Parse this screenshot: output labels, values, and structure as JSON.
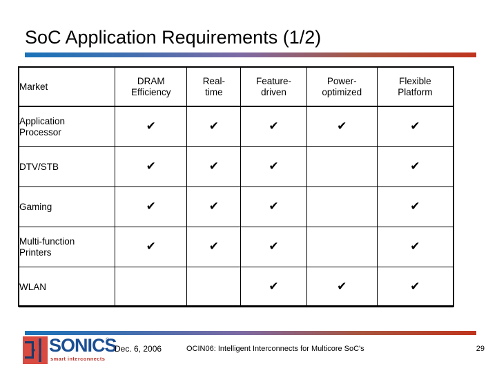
{
  "slide": {
    "title": "SoC Application Requirements (1/2)",
    "accent_blue": "#1a72b8",
    "accent_red": "#c0341d"
  },
  "table": {
    "columns": [
      "Market",
      "DRAM Efficiency",
      "Real-time",
      "Feature-driven",
      "Power-optimized",
      "Flexible Platform"
    ],
    "column_lines": [
      [
        "Market",
        ""
      ],
      [
        "DRAM",
        "Efficiency"
      ],
      [
        "Real-",
        "time"
      ],
      [
        "Feature-",
        "driven"
      ],
      [
        "Power-",
        "optimized"
      ],
      [
        "Flexible",
        "Platform"
      ]
    ],
    "check_symbol": "✔",
    "rows": [
      {
        "market_lines": [
          "Application",
          "Processor"
        ],
        "market": "Application Processor",
        "cells": [
          "✔",
          "✔",
          "✔",
          "✔",
          "✔"
        ]
      },
      {
        "market_lines": [
          "DTV/STB",
          ""
        ],
        "market": "DTV/STB",
        "cells": [
          "✔",
          "✔",
          "✔",
          "",
          "✔"
        ]
      },
      {
        "market_lines": [
          "Gaming",
          ""
        ],
        "market": "Gaming",
        "cells": [
          "✔",
          "✔",
          "✔",
          "",
          "✔"
        ]
      },
      {
        "market_lines": [
          "Multi-function",
          "Printers"
        ],
        "market": "Multi-function Printers",
        "cells": [
          "✔",
          "✔",
          "✔",
          "",
          "✔"
        ]
      },
      {
        "market_lines": [
          "WLAN",
          ""
        ],
        "market": "WLAN",
        "cells": [
          "",
          "",
          "✔",
          "✔",
          "✔"
        ]
      }
    ]
  },
  "footer": {
    "logo_word": "SONICS",
    "logo_registered": "®",
    "logo_tagline": "smart interconnects",
    "date": "Dec. 6, 2006",
    "conference": "OCIN06: Intelligent Interconnects for Multicore SoC's",
    "page_number": "29"
  }
}
